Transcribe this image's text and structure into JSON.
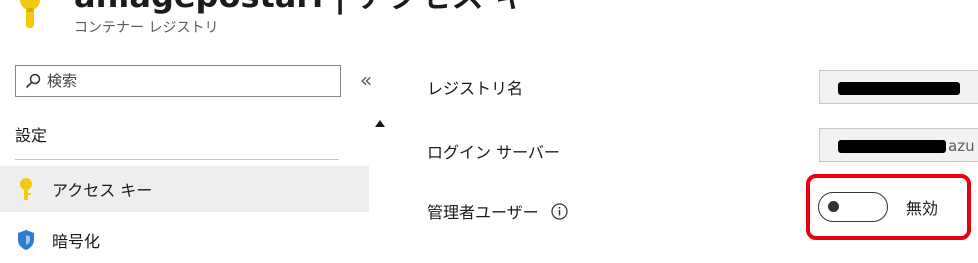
{
  "header": {
    "title": "aniagepostari | アクセス キー",
    "subtitle": "コンテナー レジストリ",
    "icon": "key-icon",
    "icon_color": "#F2C811"
  },
  "nav": {
    "search_placeholder": "検索",
    "collapse_symbol": "«",
    "section_label": "設定",
    "items": [
      {
        "label": "アクセス キー",
        "icon": "key-icon",
        "selected": true
      },
      {
        "label": "暗号化",
        "icon": "shield-icon",
        "selected": false
      }
    ]
  },
  "content": {
    "registry_name_label": "レジストリ名",
    "login_server_label": "ログイン サーバー",
    "login_server_suffix": "azu",
    "admin_user_label": "管理者ユーザー",
    "admin_user_state": "無効",
    "admin_user_enabled": false
  },
  "colors": {
    "highlight_border": "#E60012",
    "selected_nav_bg": "#EEEEEE",
    "key_icon": "#F2C811",
    "shield_icon": "#2E7DD1"
  }
}
